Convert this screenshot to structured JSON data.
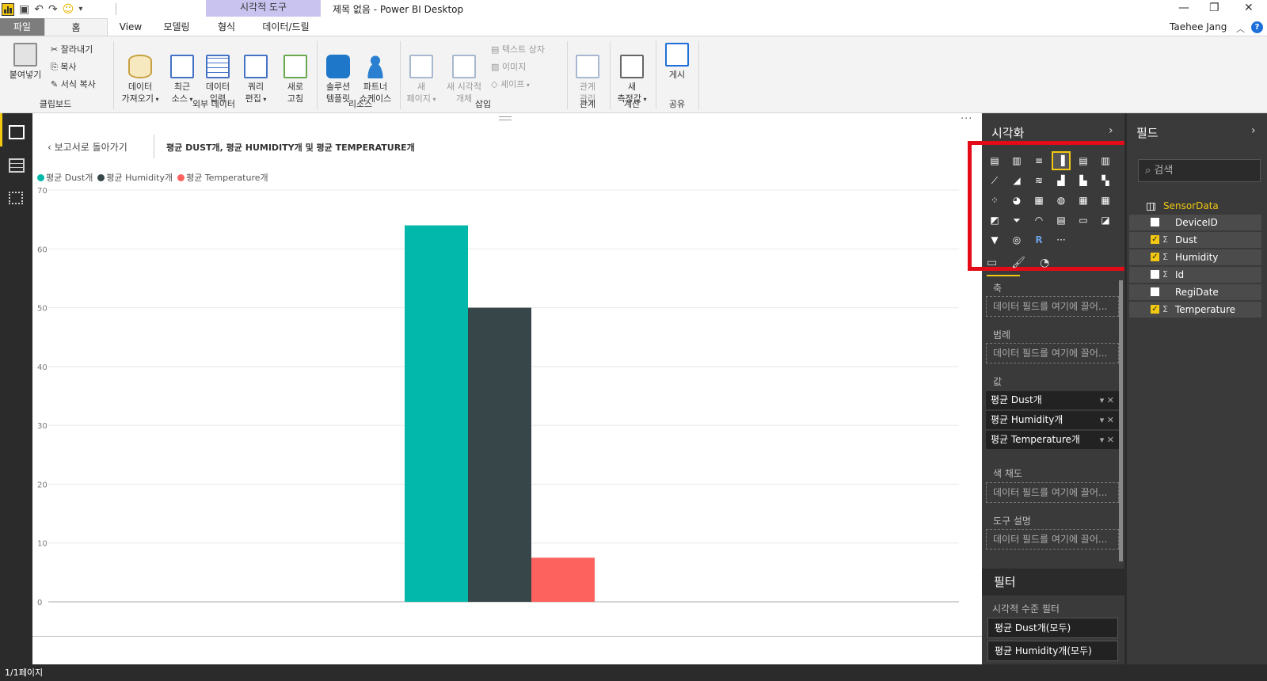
{
  "window": {
    "title": "제목 없음 - Power BI Desktop",
    "context_tab_group": "시각적 도구",
    "user": "Taehee Jang",
    "help": "?"
  },
  "tabs": [
    "파일",
    "홈",
    "View",
    "모델링",
    "형식",
    "데이터/드릴"
  ],
  "ribbon": {
    "clipboard": {
      "paste": "붙여넣기",
      "cut": "잘라내기",
      "copy": "복사",
      "format_painter": "서식 복사",
      "group": "클립보드"
    },
    "external_data": {
      "get_data": "데이터\n가져오기",
      "recent": "최근\n소스",
      "enter_data": "데이터\n입력",
      "edit_queries": "쿼리\n편집",
      "refresh": "새로\n고침",
      "group": "외부 데이터"
    },
    "resources": {
      "solution_templates": "솔루션\n템플릿",
      "partner_showcase": "파트너\n쇼케이스",
      "group": "리소스"
    },
    "insert": {
      "new_page": "새\n페이지",
      "new_visual": "새 시각적\n개체",
      "text_box": "텍스트 상자",
      "image": "이미지",
      "shapes": "셰이프",
      "group": "삽입"
    },
    "relationships": {
      "manage": "관계\n관리",
      "group": "관계"
    },
    "calculations": {
      "new_measure": "새\n측정값",
      "group": "계산"
    },
    "share": {
      "publish": "게시",
      "group": "공유"
    }
  },
  "canvas": {
    "back_label": "보고서로 돌아가기",
    "chart_title": "평균 DUST개, 평균 HUMIDITY개 및 평균 TEMPERATURE개",
    "status": "1/1페이지"
  },
  "chart_data": {
    "type": "bar",
    "title": "평균 DUST개, 평균 HUMIDITY개 및 평균 TEMPERATURE개",
    "xlabel": "",
    "ylabel": "",
    "ylim": [
      0,
      70
    ],
    "yticks": [
      0,
      10,
      20,
      30,
      40,
      50,
      60,
      70
    ],
    "grid": true,
    "legend_position": "top-left",
    "series": [
      {
        "name": "평균 Dust개",
        "value": 64,
        "color": "#01b8aa"
      },
      {
        "name": "평균 Humidity개",
        "value": 50,
        "color": "#374649"
      },
      {
        "name": "평균 Temperature개",
        "value": 7.5,
        "color": "#fd625e"
      }
    ]
  },
  "viz_pane": {
    "title": "시각화",
    "wells": [
      {
        "label": "축",
        "placeholder": "데이터 필드를 여기에 끌어..."
      },
      {
        "label": "범례",
        "placeholder": "데이터 필드를 여기에 끌어..."
      },
      {
        "label": "값",
        "placeholder": ""
      },
      {
        "label": "색 채도",
        "placeholder": "데이터 필드를 여기에 끌어..."
      },
      {
        "label": "도구 설명",
        "placeholder": "데이터 필드를 여기에 끌어..."
      }
    ],
    "value_fields": [
      "평균 Dust개",
      "평균 Humidity개",
      "평균 Temperature개"
    ],
    "filters_title": "필터",
    "visual_level_filters": "시각적 수준 필터",
    "filter_items": [
      "평균 Dust개(모두)",
      "평균 Humidity개(모두)"
    ]
  },
  "fields_pane": {
    "title": "필드",
    "search_placeholder": "검색",
    "table": "SensorData",
    "fields": [
      {
        "name": "DeviceID",
        "checked": false,
        "sigma": false
      },
      {
        "name": "Dust",
        "checked": true,
        "sigma": true
      },
      {
        "name": "Humidity",
        "checked": true,
        "sigma": true
      },
      {
        "name": "Id",
        "checked": false,
        "sigma": true
      },
      {
        "name": "RegiDate",
        "checked": false,
        "sigma": false
      },
      {
        "name": "Temperature",
        "checked": true,
        "sigma": true
      }
    ]
  }
}
